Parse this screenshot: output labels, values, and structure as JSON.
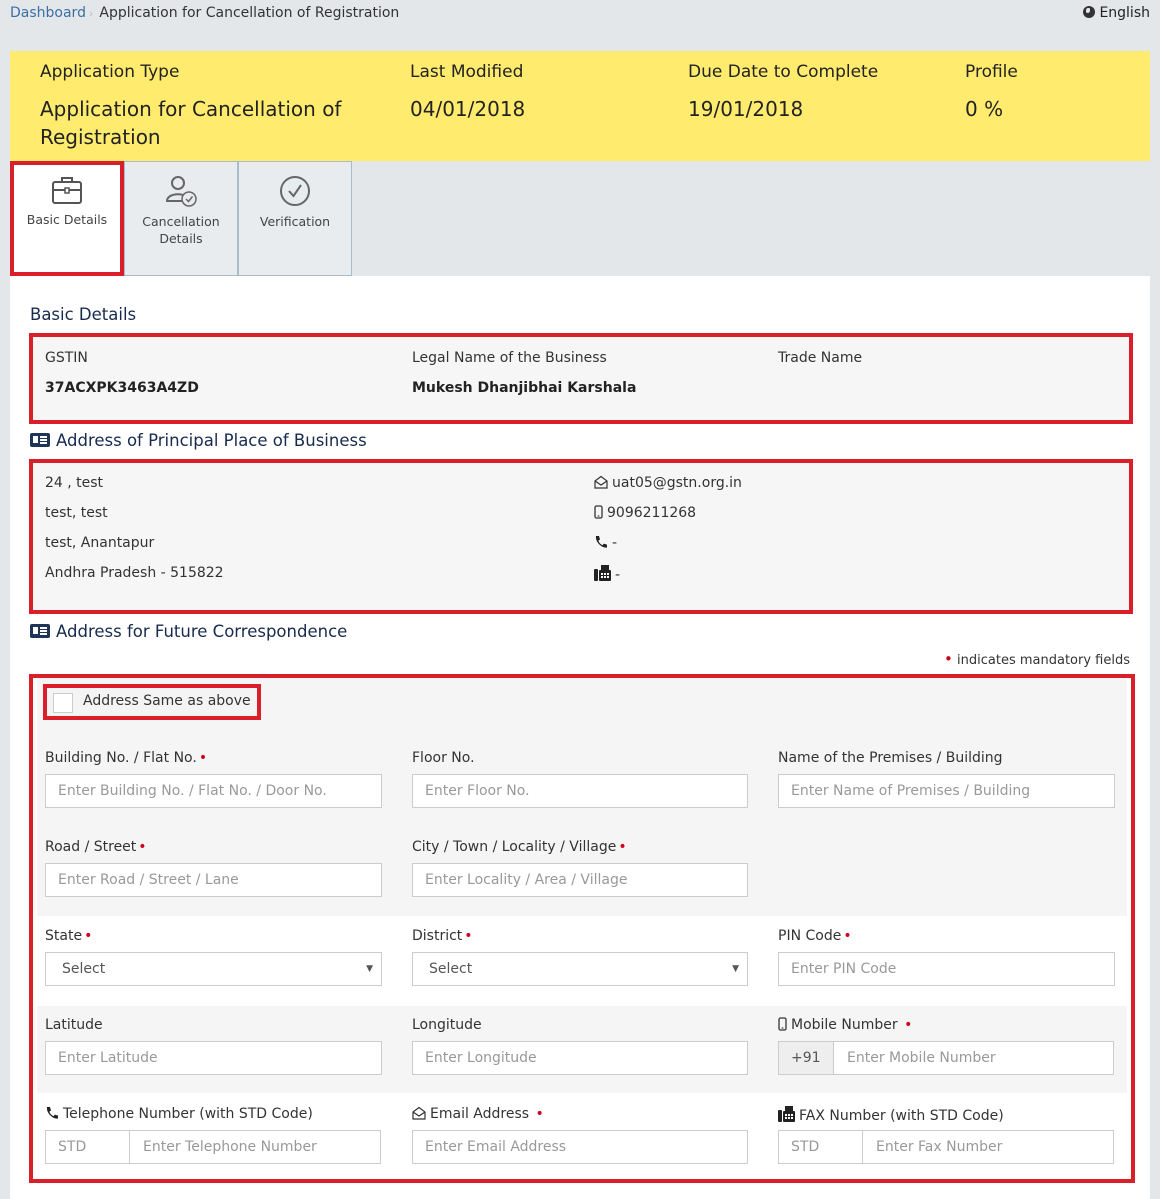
{
  "breadcrumb": {
    "home": "Dashboard",
    "current": "Application for Cancellation of Registration"
  },
  "language": {
    "icon": "globe-icon",
    "label": "English"
  },
  "info_bar": {
    "bg_color": "#ffec6e",
    "application_type_label": "Application Type",
    "application_type_value": "Application for Cancellation of Registration",
    "last_modified_label": "Last Modified",
    "last_modified_value": "04/01/2018",
    "due_date_label": "Due Date to Complete",
    "due_date_value": "19/01/2018",
    "profile_label": "Profile",
    "profile_value": "0 %"
  },
  "tabs": [
    {
      "label": "Basic Details",
      "icon": "briefcase-icon",
      "active": true
    },
    {
      "label": "Cancellation Details",
      "icon": "user-check-icon",
      "active": false
    },
    {
      "label": "Verification",
      "icon": "check-circle-icon",
      "active": false
    }
  ],
  "basic_details": {
    "title": "Basic Details",
    "gstin_label": "GSTIN",
    "gstin_value": "37ACXPK3463A4ZD",
    "legal_name_label": "Legal Name of the Business",
    "legal_name_value": "Mukesh Dhanjibhai Karshala",
    "trade_name_label": "Trade Name",
    "trade_name_value": ""
  },
  "principal_address": {
    "title": "Address of Principal Place of Business",
    "lines": [
      "24 , test",
      "test, test",
      "test, Anantapur",
      "Andhra Pradesh - 515822"
    ],
    "email": "uat05@gstn.org.in",
    "mobile": "9096211268",
    "telephone": "-",
    "fax": "-"
  },
  "future_address": {
    "title": "Address for Future Correspondence",
    "mandatory_note": "indicates mandatory fields",
    "same_as_above_label": "Address Same as above",
    "same_as_above_checked": false,
    "fields": {
      "building_label": "Building No. / Flat No.",
      "building_placeholder": "Enter Building No. / Flat No. / Door No.",
      "floor_label": "Floor No.",
      "floor_placeholder": "Enter Floor No.",
      "premises_label": "Name of the Premises / Building",
      "premises_placeholder": "Enter Name of Premises / Building",
      "road_label": "Road / Street",
      "road_placeholder": "Enter Road / Street / Lane",
      "city_label": "City / Town / Locality / Village",
      "city_placeholder": "Enter Locality / Area / Village",
      "state_label": "State",
      "state_value": "Select",
      "district_label": "District",
      "district_value": "Select",
      "pin_label": "PIN Code",
      "pin_placeholder": "Enter PIN Code",
      "latitude_label": "Latitude",
      "latitude_placeholder": "Enter Latitude",
      "longitude_label": "Longitude",
      "longitude_placeholder": "Enter Longitude",
      "mobile_label": "Mobile Number",
      "mobile_prefix": "+91",
      "mobile_placeholder": "Enter Mobile Number",
      "telephone_label": "Telephone Number (with STD Code)",
      "telephone_std_placeholder": "STD",
      "telephone_placeholder": "Enter Telephone Number",
      "email_label": "Email Address",
      "email_placeholder": "Enter Email Address",
      "fax_label": "FAX Number (with STD Code)",
      "fax_std_placeholder": "STD",
      "fax_placeholder": "Enter Fax Number"
    },
    "required_marker": "•"
  },
  "colors": {
    "highlight_red": "#d9202a",
    "link_blue": "#3a6ea5",
    "required_red": "#d0021b"
  }
}
